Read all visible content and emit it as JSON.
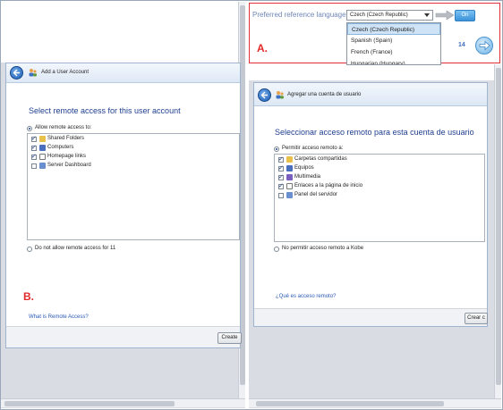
{
  "colors": {
    "accent": "#1f3f8f",
    "link": "#2a58b5",
    "callout": "#e0303a",
    "on_button": "#3b93d8"
  },
  "callouts": {
    "a": "A.",
    "b": "B."
  },
  "translation_bar": {
    "label": "Preferred reference language",
    "selected": "Czech (Czech Republic)",
    "options": [
      "Czech (Czech Republic)",
      "Spanish (Spain)",
      "French (France)",
      "Hungarian (Hungary)"
    ],
    "toggle_label": "On",
    "page_number": "14",
    "icons": [
      "chevron-down-icon",
      "arrow-right-icon",
      "next-circle-icon"
    ]
  },
  "left_dialog": {
    "title": "Add a User Account",
    "heading": "Select remote access for this user account",
    "allow_label": "Allow remote access to:",
    "items": [
      {
        "label": "Shared Folders",
        "checked": true,
        "icon": "folder-icon"
      },
      {
        "label": "Computers",
        "checked": true,
        "icon": "computer-icon"
      },
      {
        "label": "Homepage links",
        "checked": true,
        "icon": "link-icon"
      },
      {
        "label": "Server Dashboard",
        "checked": false,
        "icon": "dashboard-icon"
      }
    ],
    "deny_label": "Do not allow remote access for 11",
    "help_link": "What is Remote Access?",
    "create_button": "Create"
  },
  "right_dialog": {
    "title": "Agregar una cuenta de usuario",
    "heading": "Seleccionar acceso remoto para esta cuenta de usuario",
    "allow_label": "Permitir acceso remoto a:",
    "items": [
      {
        "label": "Carpetas compartidas",
        "checked": true,
        "icon": "folder-icon"
      },
      {
        "label": "Equipos",
        "checked": true,
        "icon": "computer-icon"
      },
      {
        "label": "Multimedia",
        "checked": true,
        "icon": "media-icon"
      },
      {
        "label": "Enlaces a la página de inicio",
        "checked": true,
        "icon": "link-icon"
      },
      {
        "label": "Panel del servidor",
        "checked": false,
        "icon": "dashboard-icon"
      }
    ],
    "deny_label": "No permitir acceso remoto a Kobe",
    "help_link": "¿Qué es acceso remoto?",
    "create_button": "Crear c"
  }
}
